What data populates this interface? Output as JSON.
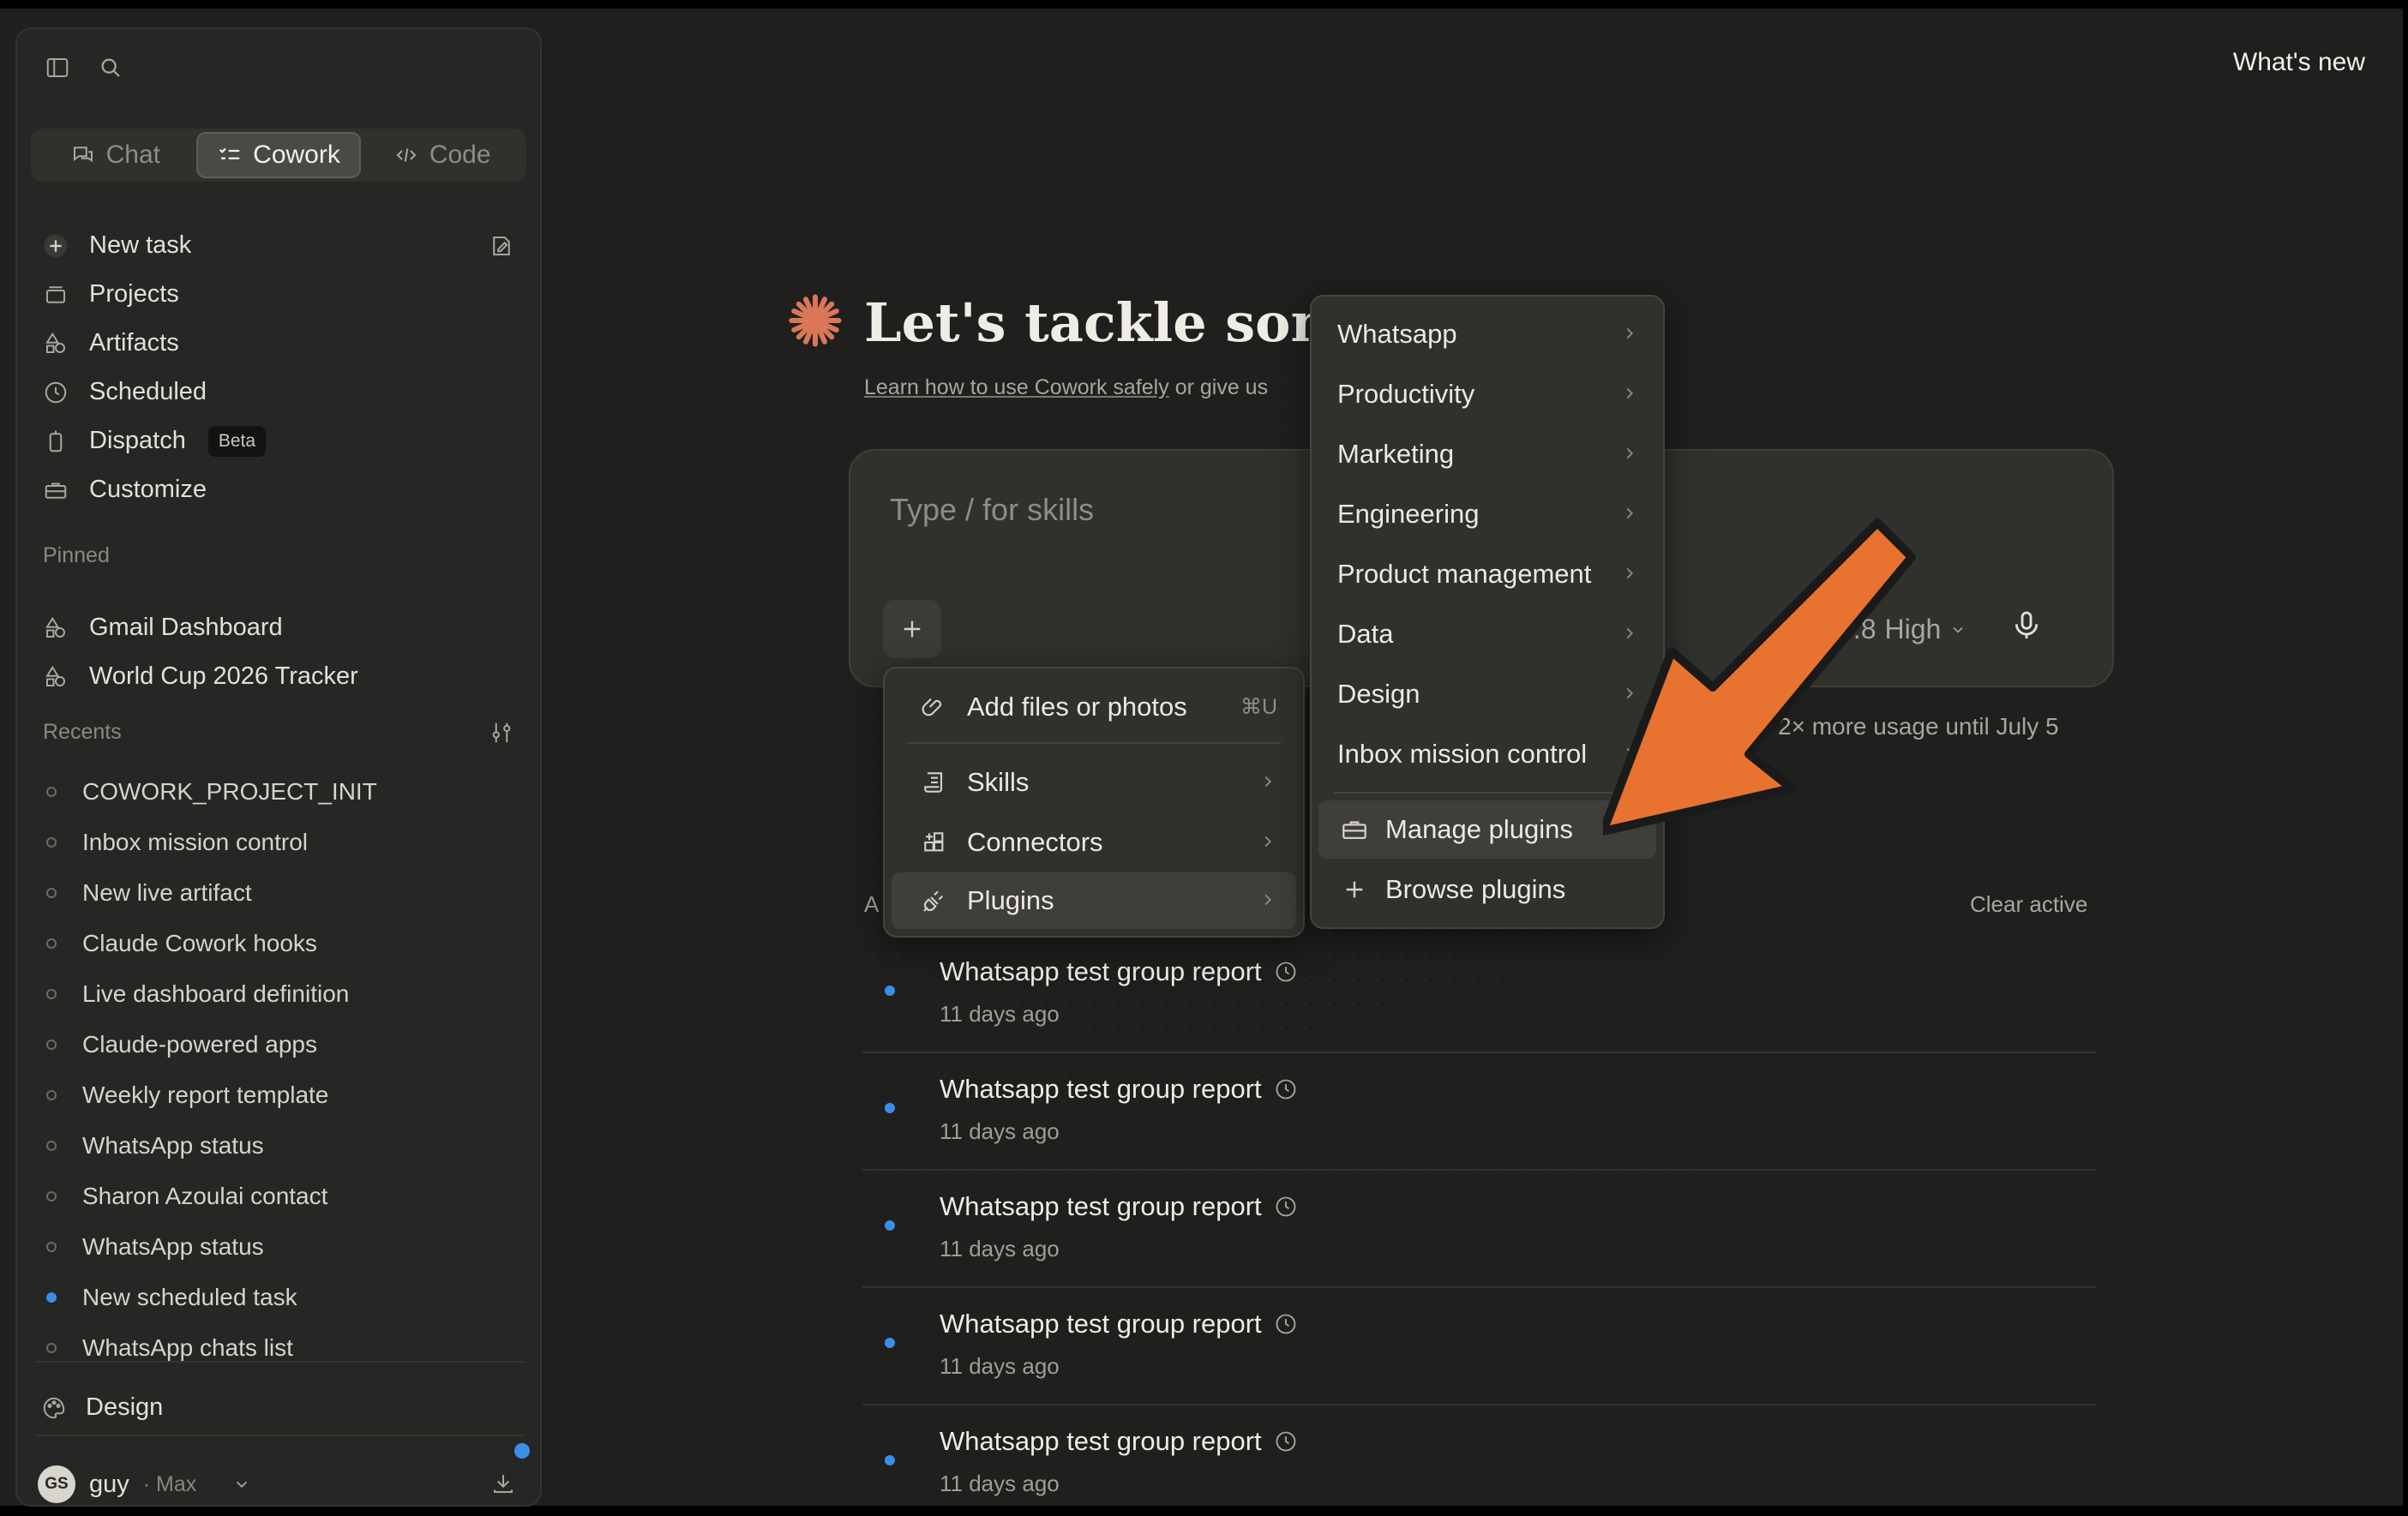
{
  "header": {
    "whats_new": "What's new"
  },
  "sidebar": {
    "tabs": [
      {
        "label": "Chat",
        "icon": "chat-icon"
      },
      {
        "label": "Cowork",
        "icon": "checklist-icon"
      },
      {
        "label": "Code",
        "icon": "code-icon"
      }
    ],
    "nav": {
      "new_task": "New task",
      "projects": "Projects",
      "artifacts": "Artifacts",
      "scheduled": "Scheduled",
      "dispatch": "Dispatch",
      "dispatch_badge": "Beta",
      "customize": "Customize"
    },
    "pinned_label": "Pinned",
    "pinned": [
      "Gmail Dashboard",
      "World Cup 2026 Tracker"
    ],
    "recents_label": "Recents",
    "recents": [
      "COWORK_PROJECT_INIT",
      "Inbox mission control",
      "New live artifact",
      "Claude Cowork hooks",
      "Live dashboard definition",
      "Claude-powered apps",
      "Weekly report template",
      "WhatsApp status",
      "Sharon Azoulai contact",
      "WhatsApp status",
      "New scheduled task",
      "WhatsApp chats list"
    ],
    "design": "Design",
    "user": {
      "initials": "GS",
      "name": "guy",
      "plan": "· Max"
    }
  },
  "hero": {
    "title": "Let's tackle something",
    "subtitle_link": "Learn how to use Cowork safely",
    "subtitle_rest": " or give us"
  },
  "composer": {
    "placeholder": "Type / for skills",
    "model_value": "4.8",
    "model_effort": "High",
    "usage": "2× more usage until July 5"
  },
  "add_menu": {
    "add_files": "Add files or photos",
    "add_files_shortcut": "⌘U",
    "skills": "Skills",
    "connectors": "Connectors",
    "plugins": "Plugins"
  },
  "plugins_menu": {
    "categories": [
      "Whatsapp",
      "Productivity",
      "Marketing",
      "Engineering",
      "Product management",
      "Data",
      "Design",
      "Inbox mission control"
    ],
    "manage": "Manage plugins",
    "browse": "Browse plugins"
  },
  "tasks": {
    "section_label_partial": "A",
    "clear_active": "Clear active",
    "items": [
      {
        "title": "Whatsapp test group report",
        "time": "11 days ago"
      },
      {
        "title": "Whatsapp test group report",
        "time": "11 days ago"
      },
      {
        "title": "Whatsapp test group report",
        "time": "11 days ago"
      },
      {
        "title": "Whatsapp test group report",
        "time": "11 days ago"
      },
      {
        "title": "Whatsapp test group report",
        "time": "11 days ago"
      }
    ]
  },
  "colors": {
    "accent": "#d97757",
    "arrow": "#e8722f",
    "blue_dot": "#3b8ee8"
  }
}
